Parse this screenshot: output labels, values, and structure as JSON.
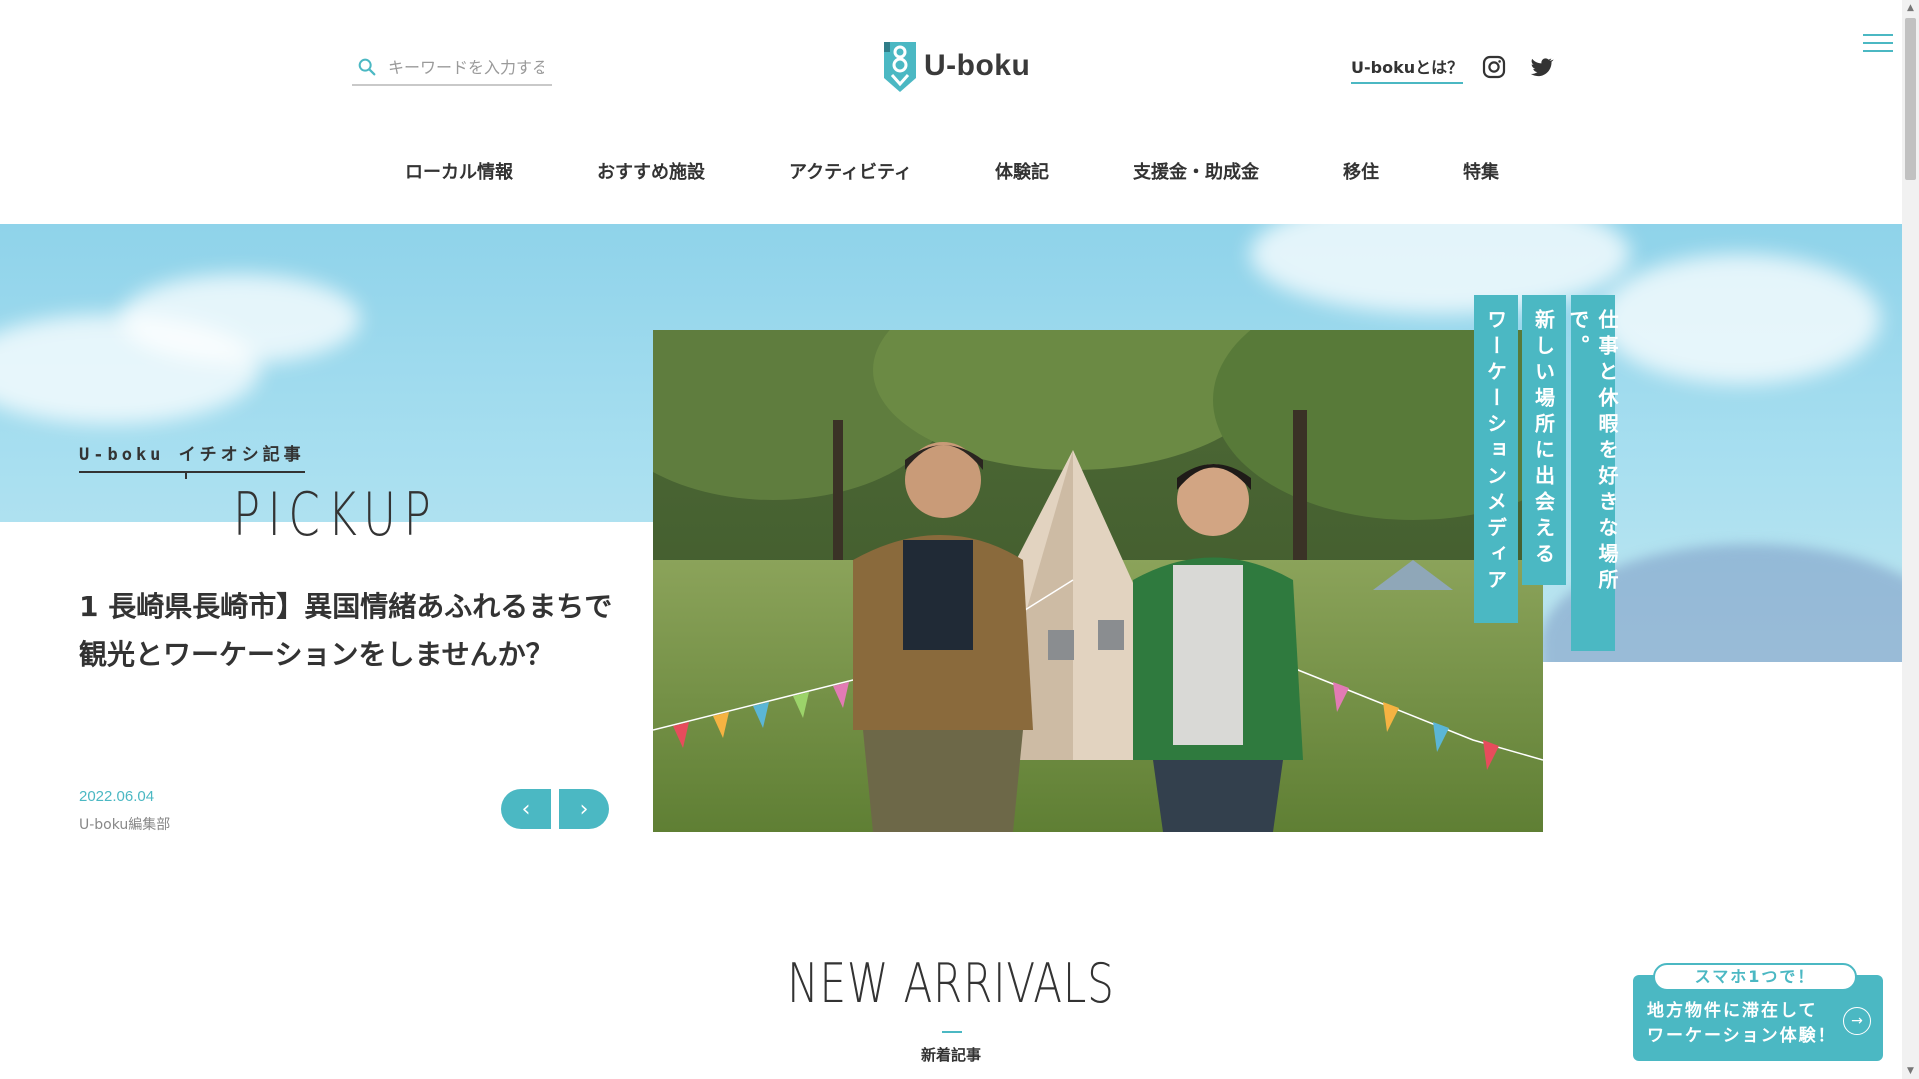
{
  "header": {
    "search_placeholder": "キーワードを入力する",
    "logo_text": "U-boku",
    "about_label": "U-bokuとは？",
    "social": [
      "instagram-icon",
      "twitter-icon"
    ]
  },
  "nav": {
    "items": [
      {
        "label": "ローカル情報"
      },
      {
        "label": "おすすめ施設"
      },
      {
        "label": "アクティビティ"
      },
      {
        "label": "体験記"
      },
      {
        "label": "支援金・助成金"
      },
      {
        "label": "移住"
      },
      {
        "label": "特集"
      }
    ]
  },
  "hero": {
    "pickup_label": "U-boku イチオシ記事",
    "pickup_title": "PICKUP",
    "article_title": "1 長崎県長崎市】異国情緒あふれるまちで観光とワーケーションをしませんか？",
    "article_date": "2022.06.04",
    "article_author": "U-boku編集部",
    "prev_label": "‹",
    "next_label": "›",
    "taglines": [
      "仕事と休暇を好きな場所で。",
      "新しい場所に出会える",
      "ワーケーションメディア"
    ]
  },
  "new_arrivals": {
    "title": "NEW ARRIVALS",
    "subtitle": "新着記事"
  },
  "floating_banner": {
    "pill": "スマホ1つで！",
    "line1": "地方物件に滞在して",
    "line2": "ワーケーション体験！",
    "arrow": "→"
  },
  "colors": {
    "accent": "#4bb8c3",
    "text": "#333333",
    "sky": "#a8dff0"
  }
}
